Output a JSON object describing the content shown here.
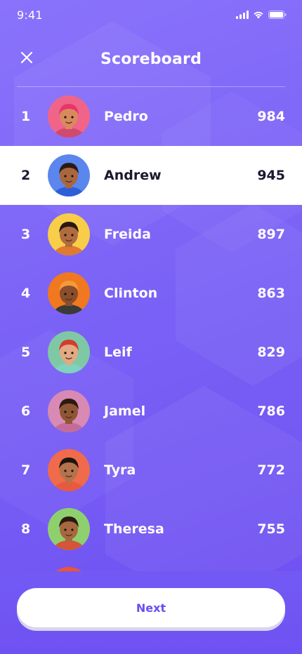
{
  "status_bar": {
    "time": "9:41"
  },
  "header": {
    "title": "Scoreboard"
  },
  "players": [
    {
      "rank": "1",
      "name": "Pedro",
      "score": "984",
      "avatar_bg": "#f0648a",
      "skin": "#d88a5e",
      "hair": "#e9346a",
      "shirt": "#d04a70"
    },
    {
      "rank": "2",
      "name": "Andrew",
      "score": "945",
      "avatar_bg": "#5b86ee",
      "skin": "#a8673f",
      "hair": "#2b1a14",
      "shirt": "#2f5fd8"
    },
    {
      "rank": "3",
      "name": "Freida",
      "score": "897",
      "avatar_bg": "#f7cd4a",
      "skin": "#b06b3f",
      "hair": "#2a1810",
      "shirt": "#e07a30"
    },
    {
      "rank": "4",
      "name": "Clinton",
      "score": "863",
      "avatar_bg": "#f0781e",
      "skin": "#8a4e2c",
      "hair": "#f39a3b",
      "shirt": "#3a3a3a"
    },
    {
      "rank": "5",
      "name": "Leif",
      "score": "829",
      "avatar_bg": "#7fc8a6",
      "skin": "#e2a982",
      "hair": "#d43b2f",
      "shirt": "#7ed3bf"
    },
    {
      "rank": "6",
      "name": "Jamel",
      "score": "786",
      "avatar_bg": "#d88ab4",
      "skin": "#8e5634",
      "hair": "#2a1a12",
      "shirt": "#c46c98"
    },
    {
      "rank": "7",
      "name": "Tyra",
      "score": "772",
      "avatar_bg": "#f06a4c",
      "skin": "#b3734c",
      "hair": "#1f140f",
      "shirt": "#e85a3f"
    },
    {
      "rank": "8",
      "name": "Theresa",
      "score": "755",
      "avatar_bg": "#8fd06e",
      "skin": "#a7683f",
      "hair": "#2b1a12",
      "shirt": "#d4553a"
    }
  ],
  "highlighted_rank": "2",
  "footer": {
    "next_label": "Next"
  },
  "colors": {
    "background": "#7b62f6",
    "accent": "#6b4ef0",
    "highlight_row": "#ffffff"
  },
  "icons": {
    "close": "close-icon",
    "signal": "signal-icon",
    "wifi": "wifi-icon",
    "battery": "battery-icon"
  }
}
